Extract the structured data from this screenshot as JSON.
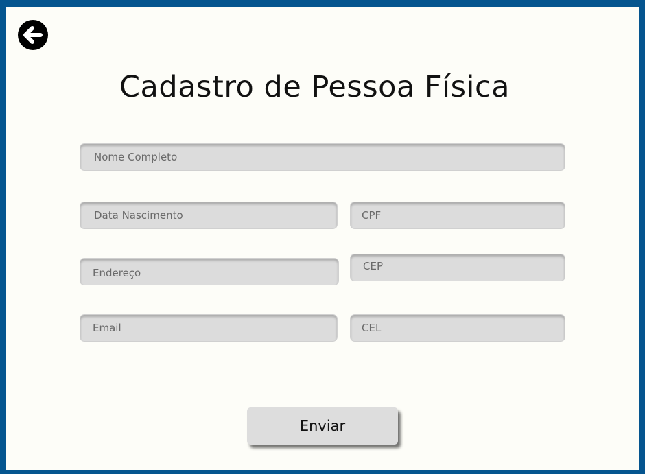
{
  "page": {
    "title": "Cadastro de Pessoa Física"
  },
  "navigation": {
    "back_icon": "arrow-left-circle-icon"
  },
  "form": {
    "full_name_placeholder": "Nome Completo",
    "birth_date_placeholder": "Data Nascimento",
    "cpf_placeholder": "CPF",
    "address_placeholder": "Endereço",
    "cep_placeholder": "CEP",
    "email_placeholder": "Email",
    "cel_placeholder": "CEL",
    "submit_label": "Enviar"
  },
  "colors": {
    "border": "#05558f",
    "background": "#fdfdf8",
    "field": "#dcdcdc"
  }
}
